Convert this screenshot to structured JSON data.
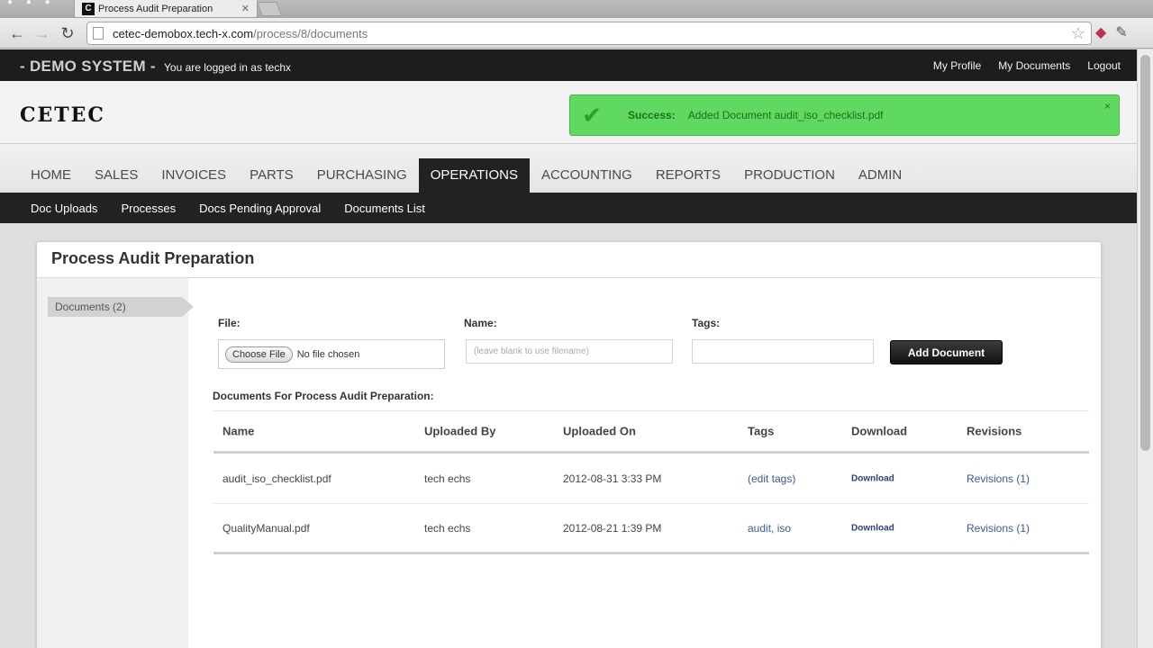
{
  "browser": {
    "tab_title": "Process Audit Preparation",
    "tab_favicon_letter": "C",
    "url_host": "cetec-demobox.tech-x.com",
    "url_path": "/process/8/documents"
  },
  "topbar": {
    "system_label": "- DEMO SYSTEM -",
    "logged_in_text": "You are logged in as techx",
    "links": [
      "My Profile",
      "My Documents",
      "Logout"
    ]
  },
  "logo": "CETEC",
  "alert": {
    "label": "Success:",
    "message": "Added Document audit_iso_checklist.pdf",
    "close": "×"
  },
  "main_nav": [
    "HOME",
    "SALES",
    "INVOICES",
    "PARTS",
    "PURCHASING",
    "OPERATIONS",
    "ACCOUNTING",
    "REPORTS",
    "PRODUCTION",
    "ADMIN"
  ],
  "main_nav_active": "OPERATIONS",
  "sub_nav": [
    "Doc Uploads",
    "Processes",
    "Docs Pending Approval",
    "Documents List"
  ],
  "panel": {
    "title": "Process Audit Preparation",
    "side_tab": "Documents (2)"
  },
  "form": {
    "file_label": "File:",
    "choose_file": "Choose File",
    "no_file": "No file chosen",
    "name_label": "Name:",
    "name_placeholder": "(leave blank to use filename)",
    "tags_label": "Tags:",
    "add_button": "Add Document"
  },
  "documents": {
    "heading": "Documents For Process Audit Preparation:",
    "columns": [
      "Name",
      "Uploaded By",
      "Uploaded On",
      "Tags",
      "Download",
      "Revisions"
    ],
    "rows": [
      {
        "name": "audit_iso_checklist.pdf",
        "uploaded_by": "tech echs",
        "uploaded_on": "2012-08-31 3:33 PM",
        "tags": "(edit tags)",
        "download": "Download",
        "revisions": "Revisions (1)"
      },
      {
        "name": "QualityManual.pdf",
        "uploaded_by": "tech echs",
        "uploaded_on": "2012-08-21 1:39 PM",
        "tags": "audit, iso",
        "download": "Download",
        "revisions": "Revisions (1)"
      }
    ]
  },
  "colors": {
    "topbar_bg": "#1d1d1d",
    "alert_bg": "#5fd95f",
    "active_nav_bg": "#222222",
    "link": "#3a5a9a"
  }
}
